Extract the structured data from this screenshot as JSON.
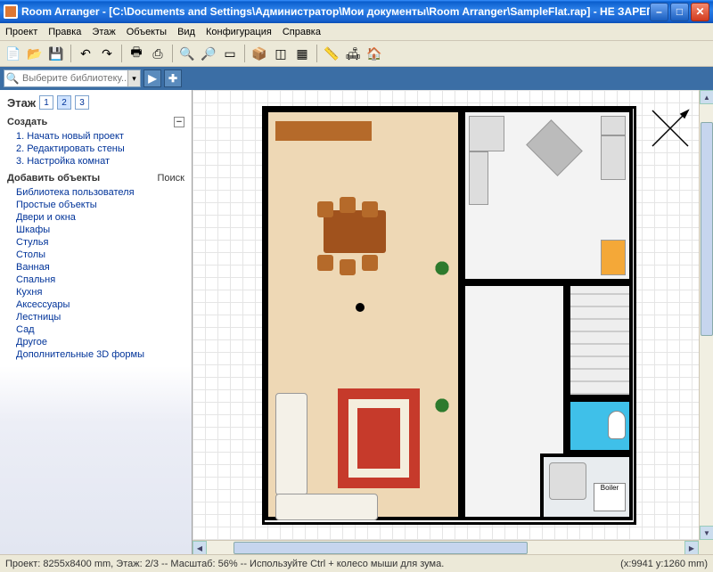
{
  "title": "Room Arranger - [C:\\Documents and Settings\\Администратор\\Мои документы\\Room Arranger\\SampleFlat.rap] - НЕ ЗАРЕГИСТРИРО...",
  "menu": [
    "Проект",
    "Правка",
    "Этаж",
    "Объекты",
    "Вид",
    "Конфигурация",
    "Справка"
  ],
  "search": {
    "placeholder": "Выберите библиотеку..."
  },
  "sidebar": {
    "floor_label": "Этаж",
    "floors": [
      "1",
      "2",
      "3"
    ],
    "active_floor": 1,
    "create": {
      "title": "Создать",
      "items": [
        "Начать новый проект",
        "Редактировать стены",
        "Настройка комнат"
      ]
    },
    "addobj": {
      "title": "Добавить объекты",
      "right": "Поиск",
      "items": [
        "Библиотека пользователя",
        "Простые объекты",
        "Двери и окна",
        "Шкафы",
        "Стулья",
        "Столы",
        "Ванная",
        "Спальня",
        "Кухня",
        "Аксессуары",
        "Лестницы",
        "Сад",
        "Другое",
        "Дополнительные 3D формы"
      ]
    }
  },
  "boiler_label": "Boiler",
  "status": {
    "left": "Проект: 8255x8400 mm, Этаж: 2/3 -- Масштаб: 56% -- Используйте Ctrl + колесо мыши для зума.",
    "right": "(x:9941 y:1260 mm)"
  }
}
